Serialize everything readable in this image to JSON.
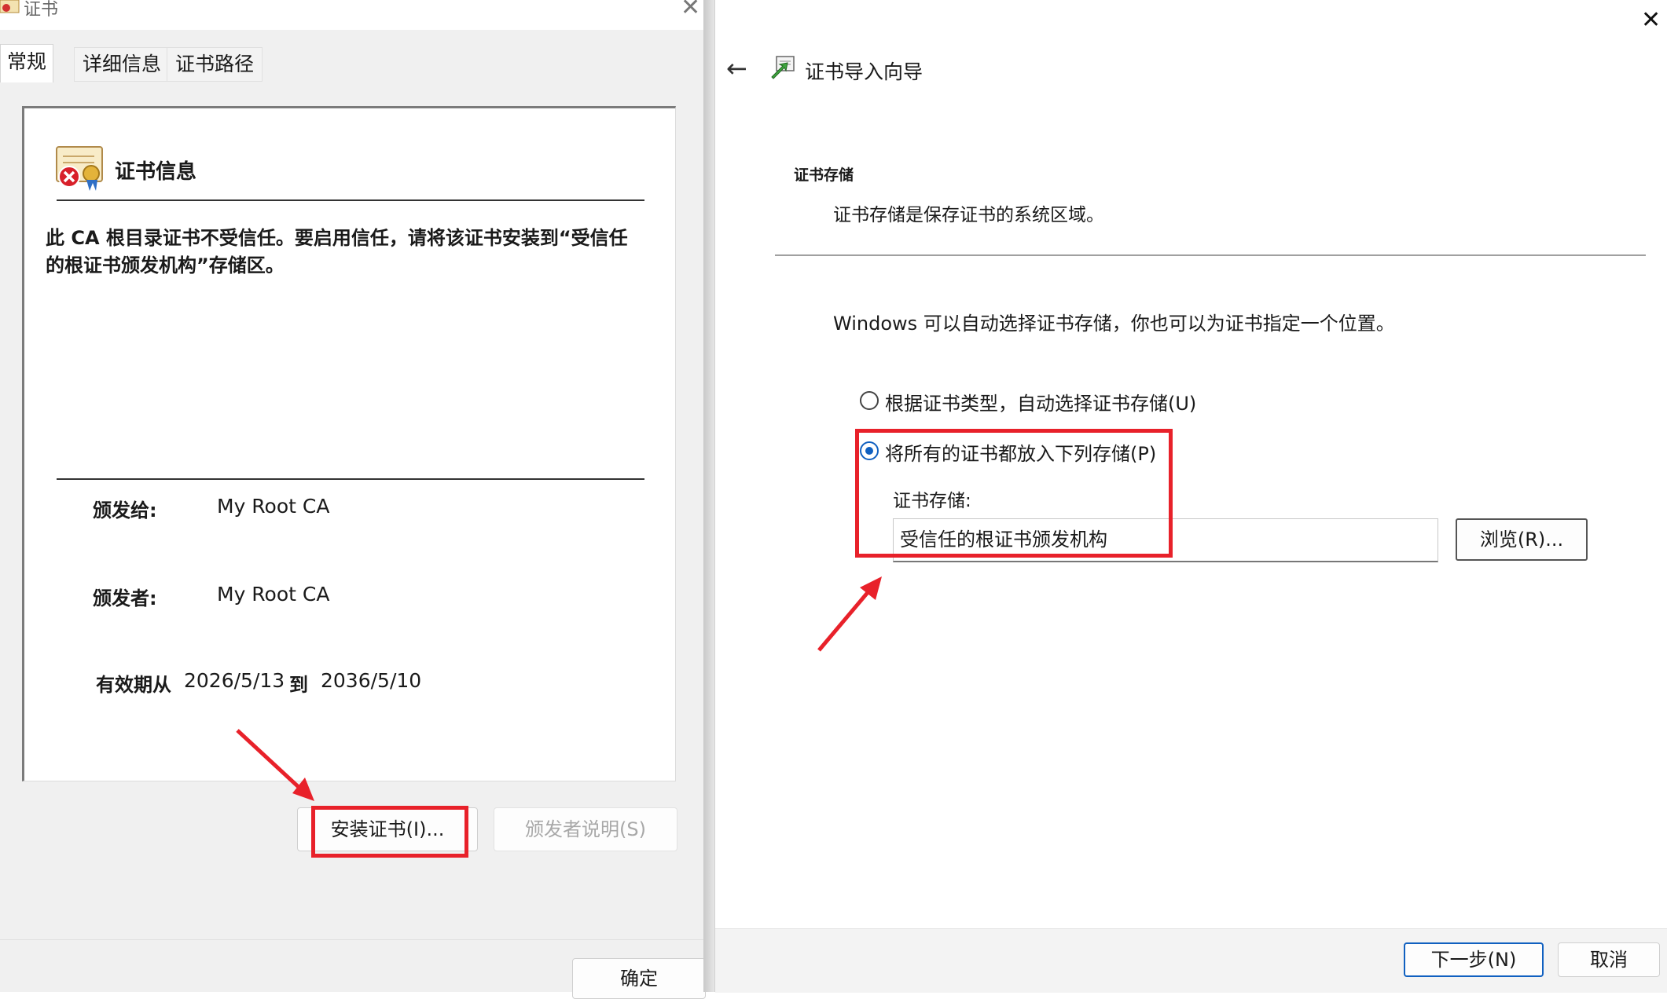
{
  "certificate_dialog": {
    "title": "证书",
    "tabs": [
      "常规",
      "详细信息",
      "证书路径"
    ],
    "info_heading": "证书信息",
    "warning": "此 CA 根目录证书不受信任。要启用信任，请将该证书安装到“受信任的根证书颁发机构”存储区。",
    "issued_to_label": "颁发给:",
    "issued_to": "My Root CA",
    "issued_by_label": "颁发者:",
    "issued_by": "My Root CA",
    "valid_from_label": "有效期从",
    "valid_from": "2026/5/13",
    "valid_to_label": "到",
    "valid_to": "2036/5/10",
    "install_button": "安装证书(I)...",
    "issuer_statement_button": "颁发者说明(S)",
    "ok_button": "确定"
  },
  "import_wizard": {
    "title": "证书导入向导",
    "section_heading": "证书存储",
    "section_description": "证书存储是保存证书的系统区域。",
    "auto_text": "Windows 可以自动选择证书存储，你也可以为证书指定一个位置。",
    "radio_auto_label": "根据证书类型，自动选择证书存储(U)",
    "radio_manual_label": "将所有的证书都放入下列存储(P)",
    "radio_selected": "manual",
    "store_label": "证书存储:",
    "store_value": "受信任的根证书颁发机构",
    "browse_button": "浏览(R)...",
    "next_button": "下一步(N)",
    "cancel_button": "取消"
  },
  "colors": {
    "highlight_red": "#e8212a",
    "accent_blue": "#1060c0"
  },
  "icons": [
    "certificate-warning-icon",
    "close-icon",
    "back-arrow-icon",
    "certificate-import-icon",
    "annotation-arrow-icon"
  ]
}
